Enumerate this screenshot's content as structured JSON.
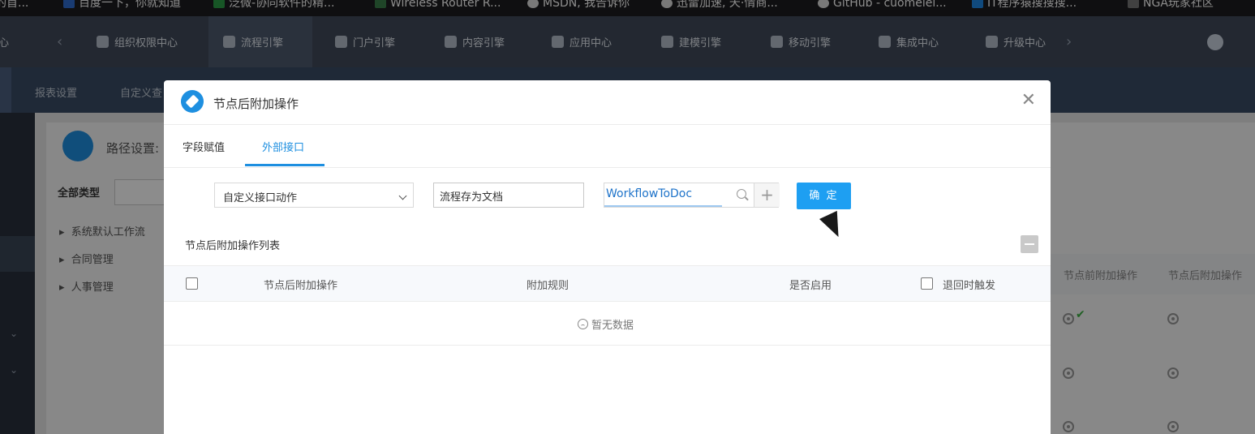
{
  "bookmarks": [
    {
      "label": "的首...",
      "icon": "bookmark-icon"
    },
    {
      "label": "百度一下，你就知道",
      "icon": "baidu-icon"
    },
    {
      "label": "泛微-协同软件的精...",
      "icon": "weaver-icon"
    },
    {
      "label": "Wireless Router R...",
      "icon": "router-icon"
    },
    {
      "label": "MSDN, 我告诉你",
      "icon": "msdn-icon"
    },
    {
      "label": "迅雷加速, 天·情商...",
      "icon": "globe-icon"
    },
    {
      "label": "GitHub - cuomeiei...",
      "icon": "github-icon"
    },
    {
      "label": "IT程序猿搜搜搜...",
      "icon": "search-page-icon"
    },
    {
      "label": "NGA玩家社区",
      "icon": "nga-icon"
    }
  ],
  "topnav": {
    "left_partial": "心",
    "items": [
      {
        "label": "组织权限中心",
        "icon": "shield-icon"
      },
      {
        "label": "流程引擎",
        "icon": "workflow-icon"
      },
      {
        "label": "门户引擎",
        "icon": "portal-icon"
      },
      {
        "label": "内容引擎",
        "icon": "document-icon"
      },
      {
        "label": "应用中心",
        "icon": "apps-icon"
      },
      {
        "label": "建模引擎",
        "icon": "cube-icon"
      },
      {
        "label": "移动引擎",
        "icon": "mobile-icon"
      },
      {
        "label": "集成中心",
        "icon": "integration-icon"
      },
      {
        "label": "升级中心",
        "icon": "upgrade-icon"
      }
    ],
    "active": "流程引擎"
  },
  "subnav": {
    "items": [
      "报表设置",
      "自定义查"
    ]
  },
  "background": {
    "path_label": "路径设置:",
    "all_types": "全部类型",
    "tree": [
      "系统默认工作流",
      "合同管理",
      "人事管理"
    ],
    "right_headers": [
      "节点前附加操作",
      "节点后附加操作"
    ]
  },
  "modal": {
    "title": "节点后附加操作",
    "tabs": [
      {
        "label": "字段赋值",
        "active": false
      },
      {
        "label": "外部接口",
        "active": true
      }
    ],
    "action_select": "自定义接口动作",
    "name_input": "流程存为文档",
    "interface_value": "WorkflowToDoc",
    "ok_button": "确 定",
    "list_title": "节点后附加操作列表",
    "table": {
      "headers": [
        "节点后附加操作",
        "附加规则",
        "是否启用",
        "退回时触发"
      ]
    },
    "empty_text": "暂无数据"
  },
  "colors": {
    "accent": "#1e9ff2",
    "topnav_bg": "#404a59",
    "subnav_bg": "#3a4c64"
  }
}
